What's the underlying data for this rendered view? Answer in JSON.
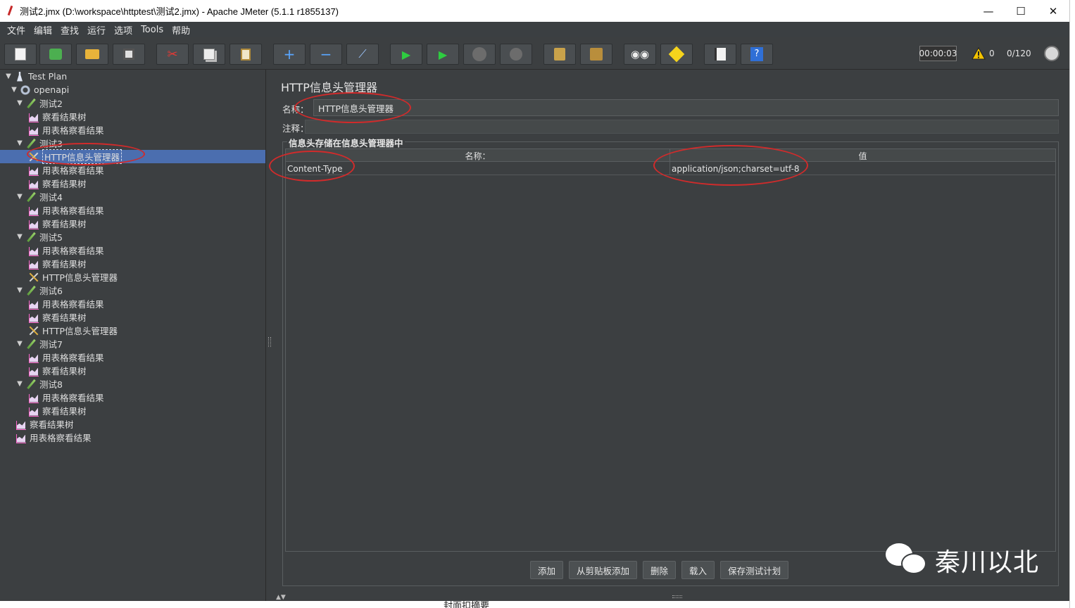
{
  "window": {
    "title": "测试2.jmx (D:\\workspace\\httptest\\测试2.jmx) - Apache JMeter (5.1.1 r1855137)",
    "minimize": "—",
    "maximize": "☐",
    "close": "✕"
  },
  "menu": [
    "文件",
    "编辑",
    "查找",
    "运行",
    "选项",
    "Tools",
    "帮助"
  ],
  "toolbar": {
    "icons": [
      "new-icon",
      "templates-icon",
      "open-icon",
      "save-icon",
      "cut-icon",
      "copy-icon",
      "paste-icon",
      "expand-icon",
      "collapse-icon",
      "toggle-icon",
      "start-icon",
      "start-no-pause-icon",
      "stop-icon",
      "shutdown-icon",
      "clear-icon",
      "clear-all-icon",
      "search-icon",
      "reset-search-icon",
      "function-helper-icon",
      "help-icon"
    ],
    "timer": "00:00:03",
    "warning_count": "0",
    "threads": "0/120"
  },
  "tree": [
    {
      "label": "Test Plan",
      "icon": "test-plan-icon",
      "level": 0,
      "expanded": true
    },
    {
      "label": "openapi",
      "icon": "thread-group-icon",
      "level": 1,
      "expanded": true
    },
    {
      "label": "测试2",
      "icon": "sampler-icon",
      "level": 2,
      "expanded": true
    },
    {
      "label": "察看结果树",
      "icon": "listener-icon",
      "level": 3
    },
    {
      "label": "用表格察看结果",
      "icon": "listener-icon",
      "level": 3
    },
    {
      "label": "测试3",
      "icon": "sampler-icon",
      "level": 2,
      "expanded": true
    },
    {
      "label": "HTTP信息头管理器",
      "icon": "config-icon",
      "level": 3,
      "selected": true
    },
    {
      "label": "用表格察看结果",
      "icon": "listener-icon",
      "level": 3
    },
    {
      "label": "察看结果树",
      "icon": "listener-icon",
      "level": 3
    },
    {
      "label": "测试4",
      "icon": "sampler-icon",
      "level": 2,
      "expanded": true
    },
    {
      "label": "用表格察看结果",
      "icon": "listener-icon",
      "level": 3
    },
    {
      "label": "察看结果树",
      "icon": "listener-icon",
      "level": 3
    },
    {
      "label": "测试5",
      "icon": "sampler-icon",
      "level": 2,
      "expanded": true
    },
    {
      "label": "用表格察看结果",
      "icon": "listener-icon",
      "level": 3
    },
    {
      "label": "察看结果树",
      "icon": "listener-icon",
      "level": 3
    },
    {
      "label": "HTTP信息头管理器",
      "icon": "config-icon",
      "level": 3
    },
    {
      "label": "测试6",
      "icon": "sampler-icon",
      "level": 2,
      "expanded": true
    },
    {
      "label": "用表格察看结果",
      "icon": "listener-icon",
      "level": 3
    },
    {
      "label": "察看结果树",
      "icon": "listener-icon",
      "level": 3
    },
    {
      "label": "HTTP信息头管理器",
      "icon": "config-icon",
      "level": 3
    },
    {
      "label": "测试7",
      "icon": "sampler-icon",
      "level": 2,
      "expanded": true
    },
    {
      "label": "用表格察看结果",
      "icon": "listener-icon",
      "level": 3
    },
    {
      "label": "察看结果树",
      "icon": "listener-icon",
      "level": 3
    },
    {
      "label": "测试8",
      "icon": "sampler-icon",
      "level": 2,
      "expanded": true
    },
    {
      "label": "用表格察看结果",
      "icon": "listener-icon",
      "level": 3
    },
    {
      "label": "察看结果树",
      "icon": "listener-icon",
      "level": 3
    },
    {
      "label": "察看结果树",
      "icon": "listener-icon",
      "level": 2
    },
    {
      "label": "用表格察看结果",
      "icon": "listener-icon",
      "level": 2
    }
  ],
  "panel": {
    "title": "HTTP信息头管理器",
    "name_label": "名称：",
    "name_value": "HTTP信息头管理器",
    "comment_label": "注释：",
    "group_title": "信息头存储在信息头管理器中",
    "columns": [
      "名称：",
      "值"
    ],
    "rows": [
      {
        "name": "Content-Type",
        "value": "application/json;charset=utf-8"
      }
    ],
    "buttons": [
      "添加",
      "从剪贴板添加",
      "删除",
      "载入",
      "保存测试计划"
    ]
  },
  "watermark": "秦川以北",
  "bottom_text": "封面扣摘要",
  "colors": {
    "panel_bg": "#3c3f41",
    "selection": "#4b6eaf",
    "annotation": "#d12b2b"
  }
}
